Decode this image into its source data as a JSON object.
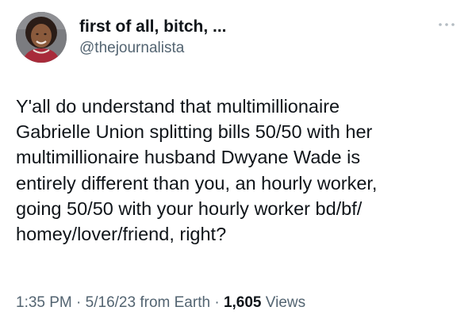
{
  "tweet": {
    "author": {
      "display_name": "first of all, bitch, ...",
      "handle": "@thejournalista"
    },
    "text": "Y'all do understand that multimillionaire\nGabrielle Union splitting bills 50/50 with her\nmultimillionaire husband Dwyane Wade is\nentirely different than you, an hourly worker,\ngoing 50/50 with your hourly worker bd/bf/\nhomey/lover/friend, right?",
    "meta": {
      "time": "1:35 PM",
      "separator": "·",
      "date": "5/16/23",
      "source": "from Earth",
      "views_count": "1,605",
      "views_label": "Views"
    }
  },
  "icons": {
    "avatar": "profile-photo",
    "more": "more-horizontal-icon"
  },
  "colors": {
    "text_primary": "#0f1419",
    "text_secondary": "#536471",
    "background": "#ffffff"
  }
}
